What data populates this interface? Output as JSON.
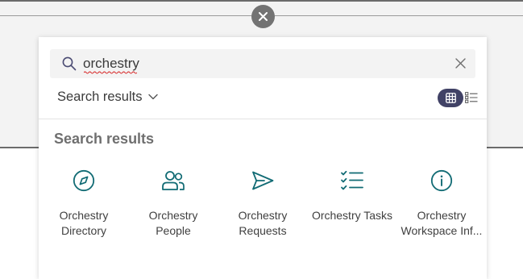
{
  "search": {
    "query": "orchestry"
  },
  "scope_dropdown": {
    "label": "Search results"
  },
  "section": {
    "title": "Search results"
  },
  "view_toggle": {
    "active": "grid",
    "accent_color": "#414266"
  },
  "results": [
    {
      "label": "Orchestry Directory",
      "icon": "compass-icon"
    },
    {
      "label": "Orchestry People",
      "icon": "people-icon"
    },
    {
      "label": "Orchestry Requests",
      "icon": "send-icon"
    },
    {
      "label": "Orchestry Tasks",
      "icon": "task-list-icon"
    },
    {
      "label": "Orchestry Workspace Inf...",
      "icon": "info-icon"
    }
  ],
  "colors": {
    "icon_teal": "#116b74",
    "close_bubble": "#737373",
    "text": "#404040"
  }
}
